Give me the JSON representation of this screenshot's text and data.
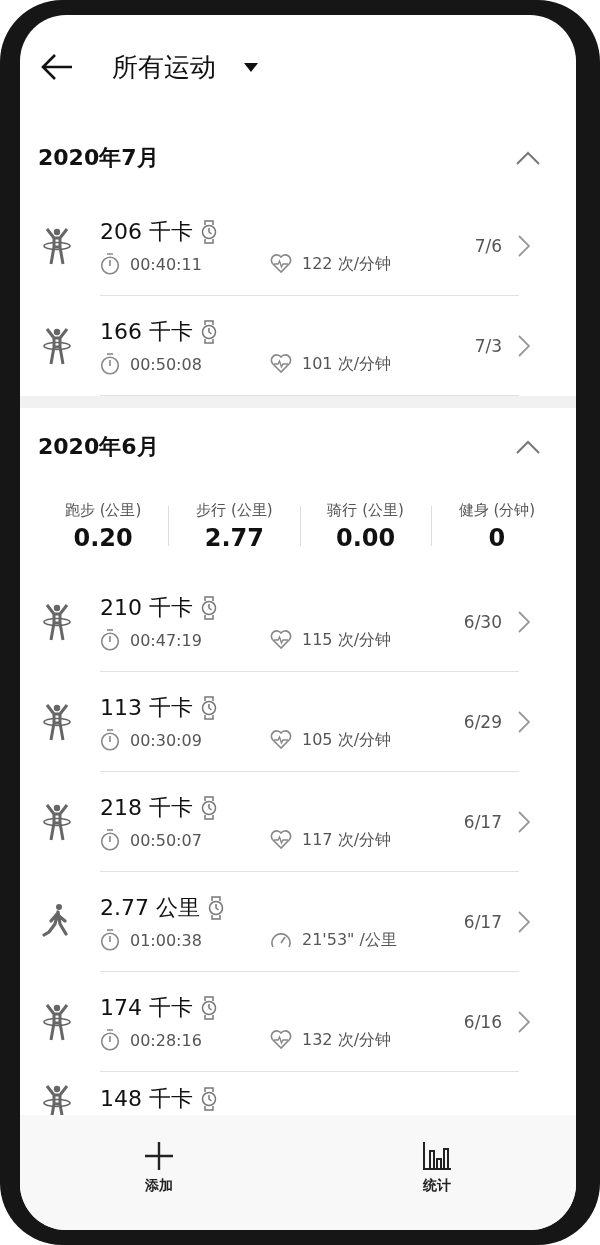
{
  "header": {
    "title": "所有运动"
  },
  "sections": [
    {
      "month": "2020年7月",
      "expanded": true,
      "records": [
        {
          "kind": "workout",
          "title": "206 千卡",
          "duration": "00:40:11",
          "metric": "122 次/分钟",
          "date": "7/6"
        },
        {
          "kind": "workout",
          "title": "166 千卡",
          "duration": "00:50:08",
          "metric": "101 次/分钟",
          "date": "7/3"
        }
      ]
    },
    {
      "month": "2020年6月",
      "expanded": true,
      "summary": [
        {
          "label": "跑步 (公里)",
          "value": "0.20"
        },
        {
          "label": "步行 (公里)",
          "value": "2.77"
        },
        {
          "label": "骑行 (公里)",
          "value": "0.00"
        },
        {
          "label": "健身 (分钟)",
          "value": "0"
        }
      ],
      "records": [
        {
          "kind": "workout",
          "title": "210 千卡",
          "duration": "00:47:19",
          "metric": "115 次/分钟",
          "date": "6/30"
        },
        {
          "kind": "workout",
          "title": "113 千卡",
          "duration": "00:30:09",
          "metric": "105 次/分钟",
          "date": "6/29"
        },
        {
          "kind": "workout",
          "title": "218 千卡",
          "duration": "00:50:07",
          "metric": "117 次/分钟",
          "date": "6/17"
        },
        {
          "kind": "walk",
          "title": "2.77 公里",
          "duration": "01:00:38",
          "metric": "21'53\" /公里",
          "date": "6/17"
        },
        {
          "kind": "workout",
          "title": "174 千卡",
          "duration": "00:28:16",
          "metric": "132 次/分钟",
          "date": "6/16"
        },
        {
          "kind": "workout",
          "title": "148 千卡"
        }
      ]
    }
  ],
  "nav": [
    {
      "kind": "add",
      "label": "添加"
    },
    {
      "kind": "stats",
      "label": "统计"
    }
  ]
}
